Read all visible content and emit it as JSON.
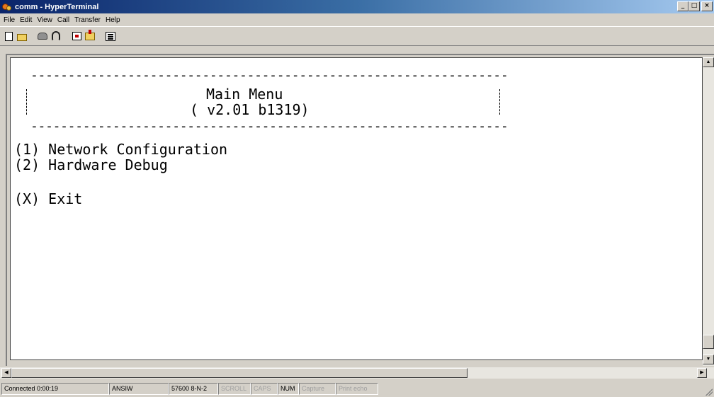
{
  "window": {
    "title": "comm - HyperTerminal",
    "minimize_glyph": "_",
    "maximize_glyph": "□",
    "close_glyph": "×"
  },
  "menu": {
    "items": [
      {
        "label": "File"
      },
      {
        "label": "Edit"
      },
      {
        "label": "View"
      },
      {
        "label": "Call"
      },
      {
        "label": "Transfer"
      },
      {
        "label": "Help"
      }
    ]
  },
  "toolbar": {
    "icons": [
      "new-document-icon",
      "open-folder-icon",
      "connect-phone-icon",
      "disconnect-icon",
      "send-file-icon",
      "receive-file-icon",
      "properties-icon"
    ]
  },
  "terminal": {
    "dash_line": "----------------------------------------------------------------",
    "title": "Main Menu",
    "version": "( v2.01 b1319)",
    "option1": "(1) Network Configuration",
    "option2": "(2) Hardware Debug",
    "exit": "(X) Exit"
  },
  "scrollbar": {
    "up_glyph": "▲",
    "down_glyph": "▼",
    "left_glyph": "◀",
    "right_glyph": "▶"
  },
  "status": {
    "connected": "Connected 0:00:19",
    "emulation": "ANSIW",
    "port_settings": "57600 8-N-2",
    "scroll": "SCROLL",
    "caps": "CAPS",
    "num": "NUM",
    "capture": "Capture",
    "print_echo": "Print echo"
  }
}
